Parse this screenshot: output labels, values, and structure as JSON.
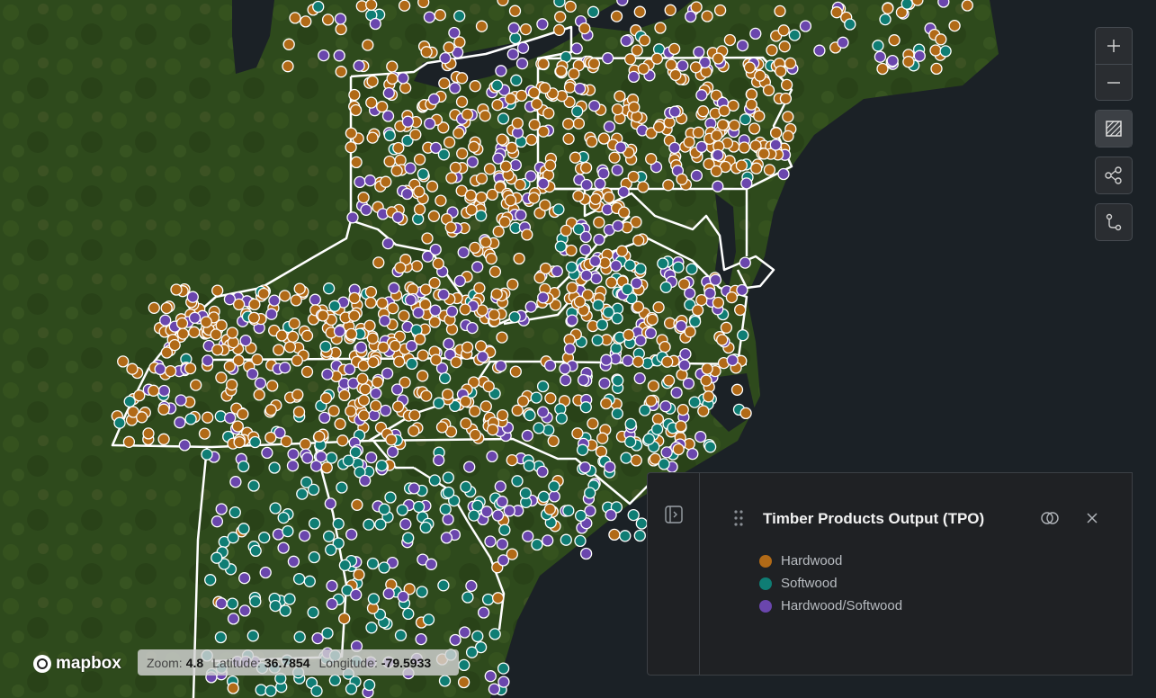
{
  "map": {
    "attribution": "mapbox",
    "colors": {
      "hardwood": "#b16a17",
      "softwood": "#0f7d74",
      "mixed": "#6a46ad",
      "boundary": "#ffffff",
      "ocean": "#1b2126"
    },
    "status": {
      "zoom_label": "Zoom:",
      "zoom": "4.8",
      "lat_label": "Latitude:",
      "lat": "36.7854",
      "lon_label": "Longitude:",
      "lon": "-79.5933"
    }
  },
  "controls": {
    "zoom_in": "zoom-in-icon",
    "zoom_out": "zoom-out-icon",
    "draw": "draw-area-icon",
    "share": "share-icon",
    "route": "route-icon"
  },
  "panel": {
    "title": "Timber Products Output (TPO)",
    "legend": [
      {
        "label": "Hardwood",
        "color": "#b16a17"
      },
      {
        "label": "Softwood",
        "color": "#0f7d74"
      },
      {
        "label": "Hardwood/Softwood",
        "color": "#6a46ad"
      }
    ]
  }
}
